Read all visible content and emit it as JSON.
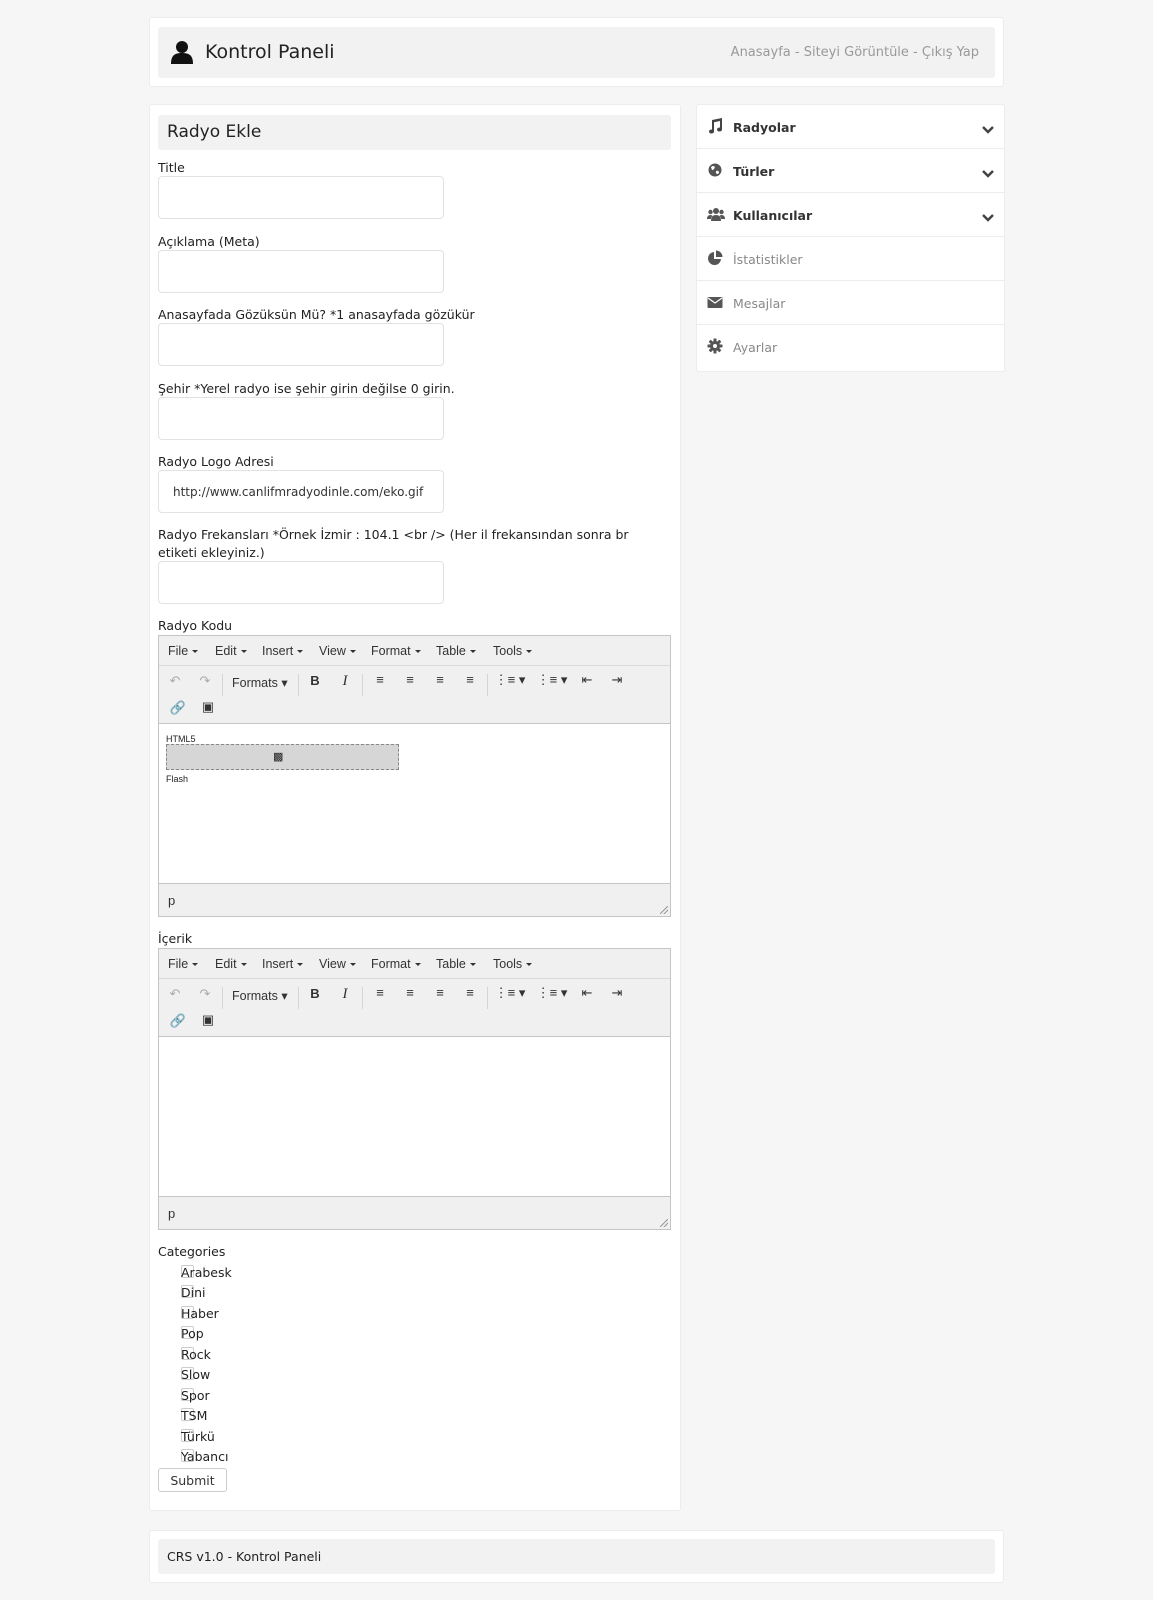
{
  "header": {
    "title": "Kontrol Paneli",
    "nav_home": "Anasayfa",
    "nav_sep1": " - ",
    "nav_view_site": "Siteyi Görüntüle",
    "nav_sep2": " - ",
    "nav_logout": "Çıkış Yap"
  },
  "form": {
    "heading": "Radyo Ekle",
    "fields": [
      {
        "label": "Title",
        "value": ""
      },
      {
        "label": "Açıklama (Meta)",
        "value": ""
      },
      {
        "label": "Anasayfada Gözüksün Mü? *1 anasayfada gözükür",
        "value": ""
      },
      {
        "label": "Şehir *Yerel radyo ise şehir girin değilse 0 girin.",
        "value": ""
      },
      {
        "label": "Radyo Logo Adresi",
        "value": "http://www.canlifmradyodinle.com/eko.gif"
      },
      {
        "label": "Radyo Frekansları *Örnek İzmir : 104.1 <br /> (Her il frekansından sonra br etiketi ekleyiniz.)",
        "value": ""
      }
    ],
    "editors": [
      {
        "label": "Radyo Kodu",
        "content_line1": "HTML5",
        "content_line2": "Flash",
        "status_path": "p"
      },
      {
        "label": "İçerik",
        "status_path": "p"
      }
    ],
    "editor_menu": [
      "File",
      "Edit",
      "Insert",
      "View",
      "Format",
      "Table",
      "Tools"
    ],
    "editor_formats_label": "Formats",
    "categories_label": "Categories",
    "categories": [
      "Arabesk",
      "Dini",
      "Haber",
      "Pop",
      "Rock",
      "Slow",
      "Spor",
      "TSM",
      "Türkü",
      "Yabancı"
    ],
    "submit_label": "Submit"
  },
  "sidebar": {
    "items": [
      {
        "label": "Radyolar",
        "icon": "music-icon",
        "expandable": true
      },
      {
        "label": "Türler",
        "icon": "globe-icon",
        "expandable": true
      },
      {
        "label": "Kullanıcılar",
        "icon": "users-icon",
        "expandable": true
      },
      {
        "label": "İstatistikler",
        "icon": "pie-chart-icon",
        "expandable": false
      },
      {
        "label": "Mesajlar",
        "icon": "envelope-icon",
        "expandable": false
      },
      {
        "label": "Ayarlar",
        "icon": "gear-icon",
        "expandable": false
      }
    ]
  },
  "footer": {
    "text": "CRS v1.0 - Kontrol Paneli"
  }
}
